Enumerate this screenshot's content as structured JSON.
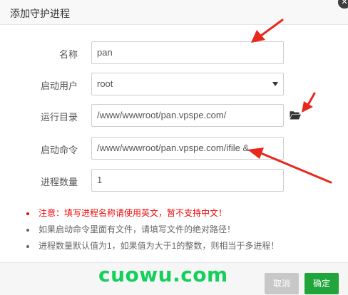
{
  "dialog": {
    "title": "添加守护进程",
    "close_glyph": "✕"
  },
  "form": {
    "name": {
      "label": "名称",
      "value": "pan"
    },
    "user": {
      "label": "启动用户",
      "value": "root"
    },
    "dir": {
      "label": "运行目录",
      "value": "/www/wwwroot/pan.vpspe.com/"
    },
    "cmd": {
      "label": "启动命令",
      "value": "/www/wwwroot/pan.vpspe.com/ifile &"
    },
    "count": {
      "label": "进程数量",
      "value": "1"
    }
  },
  "notes": [
    "注意：填写进程名称请使用英文，暂不支持中文！",
    "如果启动命令里面有文件，请填写文件的绝对路径！",
    "进程数量默认值为1，如果值为大于1的整数，则相当于多进程！"
  ],
  "footer": {
    "watermark": "cuowu.com",
    "cancel_label": "取消",
    "ok_label": "确定"
  },
  "colors": {
    "warning": "#ef0808",
    "confirm": "#20a53a",
    "watermark": "#12d05a",
    "annotation_arrow": "#e8281d"
  },
  "icons": {
    "folder": "folder-open-icon",
    "dropdown": "caret-down-icon",
    "close": "close-icon"
  }
}
